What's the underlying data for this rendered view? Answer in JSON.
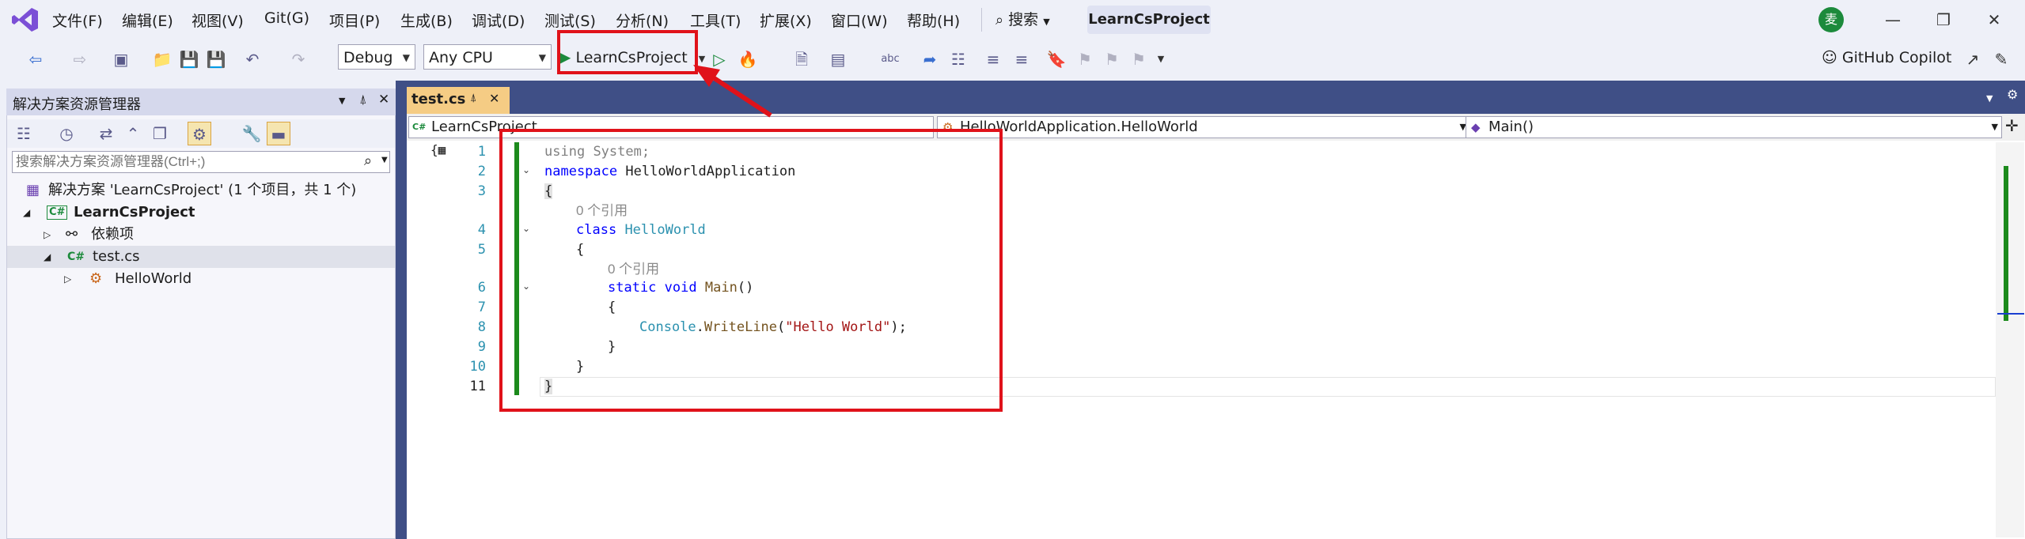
{
  "menubar": {
    "items": [
      "文件(F)",
      "编辑(E)",
      "视图(V)",
      "Git(G)",
      "项目(P)",
      "生成(B)",
      "调试(D)",
      "测试(S)",
      "分析(N)",
      "工具(T)",
      "扩展(X)",
      "窗口(W)",
      "帮助(H)"
    ],
    "search_label": "搜索",
    "project_title": "LearnCsProject",
    "avatar_initial": "麦"
  },
  "toolbar": {
    "config": "Debug",
    "platform": "Any CPU",
    "start_label": "LearnCsProject",
    "copilot_label": "GitHub Copilot"
  },
  "solution_explorer": {
    "title": "解决方案资源管理器",
    "search_placeholder": "搜索解决方案资源管理器(Ctrl+;)",
    "tree": [
      {
        "label": "解决方案 'LearnCsProject' (1 个项目，共 1 个)",
        "bold": false
      },
      {
        "label": "LearnCsProject",
        "bold": true
      },
      {
        "label": "依赖项",
        "bold": false
      },
      {
        "label": "test.cs",
        "bold": false
      },
      {
        "label": "HelloWorld",
        "bold": false
      }
    ]
  },
  "editor": {
    "tab_label": "test.cs",
    "nav_project": "LearnCsProject",
    "nav_class": "HelloWorldApplication.HelloWorld",
    "nav_member": "Main()",
    "ref_hint": "0 个引用",
    "line_numbers": [
      "1",
      "2",
      "3",
      "4",
      "5",
      "6",
      "7",
      "8",
      "9",
      "10",
      "11"
    ],
    "code": {
      "using": "using",
      "system": "System;",
      "namespace": "namespace",
      "ns_name": "HelloWorldApplication",
      "class": "class",
      "class_name": "HelloWorld",
      "static": "static",
      "void": "void",
      "main": "Main",
      "parens": "()",
      "console": "Console",
      "writeline": "WriteLine",
      "string_literal": "\"Hello World\"",
      "open_brace": "{",
      "close_brace": "}"
    }
  },
  "colors": {
    "annotation_red": "#e0121a",
    "chrome_blue": "#3f4f86",
    "active_tab": "#f5cc84"
  }
}
